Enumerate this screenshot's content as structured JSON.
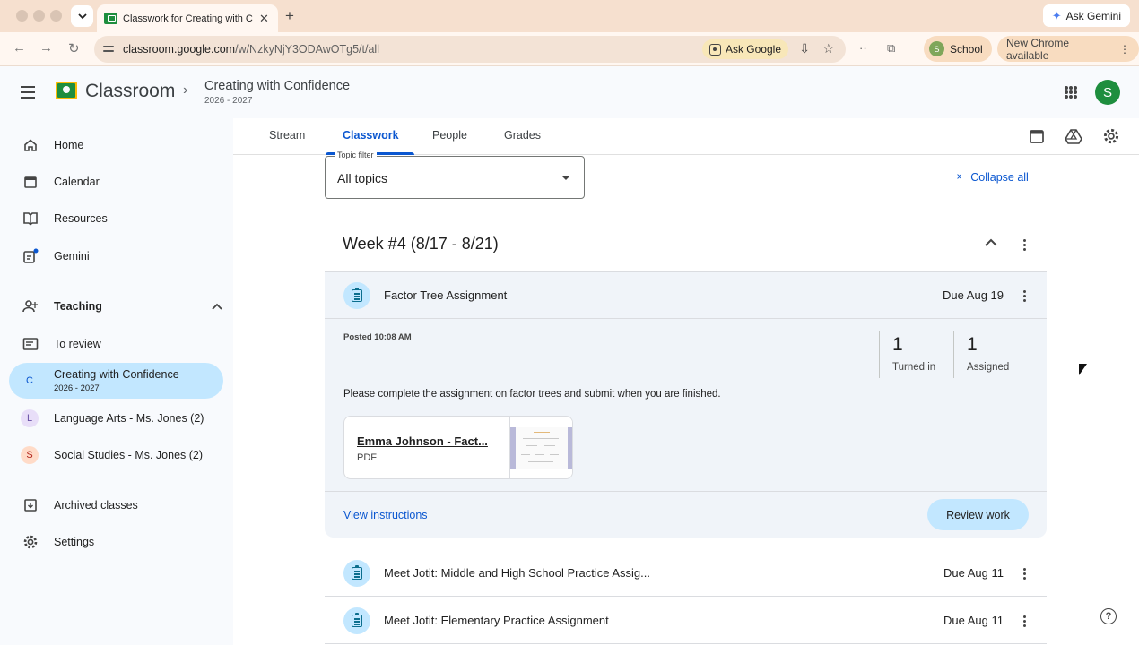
{
  "browser": {
    "tab_title": "Classwork for Creating with C",
    "tab_close": "✕",
    "new_tab": "+",
    "ask_gemini": "Ask Gemini",
    "url_domain": "classroom.google.com",
    "url_path": "/w/NzkyNjY3ODAwOTg5/t/all",
    "ask_google": "Ask Google",
    "profile_initial": "S",
    "profile_name": "School",
    "update_label": "New Chrome available"
  },
  "header": {
    "brand": "Classroom",
    "class_title": "Creating with Confidence",
    "class_year": "2026 - 2027",
    "avatar_initial": "S"
  },
  "sidebar": {
    "home": "Home",
    "calendar": "Calendar",
    "resources": "Resources",
    "gemini": "Gemini",
    "teaching": "Teaching",
    "to_review": "To review",
    "classes": [
      {
        "initial": "C",
        "name": "Creating with Confidence",
        "sub": "2026 - 2027",
        "color": "#c2e7ff",
        "text_color": "#0b57d0"
      },
      {
        "initial": "L",
        "name": "Language Arts - Ms. Jones (2)",
        "color": "#e8def8",
        "text_color": "#6750a4"
      },
      {
        "initial": "S",
        "name": "Social Studies - Ms. Jones (2)",
        "color": "#ffdbc8",
        "text_color": "#b3261e"
      }
    ],
    "archived": "Archived classes",
    "settings": "Settings"
  },
  "tabs": [
    "Stream",
    "Classwork",
    "People",
    "Grades"
  ],
  "classwork": {
    "topic_filter_label": "Topic filter",
    "topic_filter_value": "All topics",
    "collapse_all": "Collapse all",
    "week_title": "Week #4 (8/17 - 8/21)",
    "expanded": {
      "title": "Factor Tree Assignment",
      "due": "Due Aug 19",
      "posted": "Posted 10:08 AM",
      "turned_in_count": "1",
      "turned_in_label": "Turned in",
      "assigned_count": "1",
      "assigned_label": "Assigned",
      "description": "Please complete the assignment on factor trees and submit when you are finished.",
      "attachment_name": "Emma Johnson - Fact...",
      "attachment_type": "PDF",
      "view_instructions": "View instructions",
      "review_work": "Review work"
    },
    "items": [
      {
        "title": "Meet Jotit: Middle and High School Practice Assig...",
        "due": "Due Aug 11"
      },
      {
        "title": "Meet Jotit: Elementary Practice Assignment",
        "due": "Due Aug 11"
      }
    ]
  },
  "colors": {
    "accent": "#0b57d0",
    "selected": "#c2e7ff",
    "brand_green": "#1e8e3e"
  }
}
